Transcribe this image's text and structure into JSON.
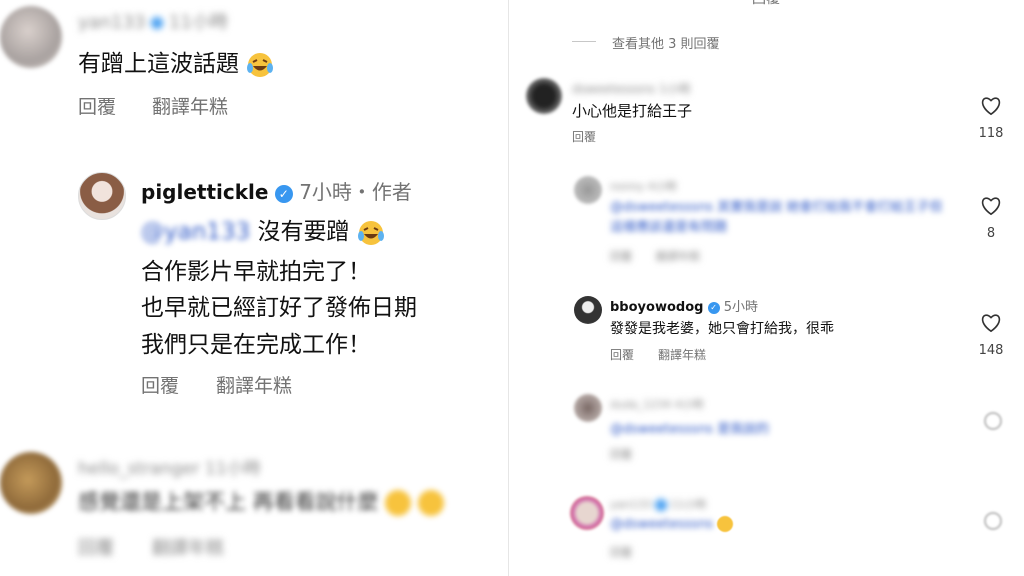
{
  "left": {
    "comment1": {
      "username": "yan133",
      "time": "11小時",
      "text": "有蹭上這波話題",
      "reply": "回覆",
      "translate": "翻譯年糕"
    },
    "reply1": {
      "username": "piglettickle",
      "time_author": "7小時・作者",
      "mention": "@yan133",
      "line1": "沒有要蹭",
      "line2": "合作影片早就拍完了！",
      "line3": "也早就已經訂好了發佈日期",
      "line4": "我們只是在完成工作！",
      "reply": "回覆",
      "translate": "翻譯年糕"
    },
    "comment2": {
      "username": "hello_stranger",
      "time": "11小時",
      "text": "感覺還是上架不上 再看看說什麼",
      "reply": "回覆",
      "translate": "翻譯年糕"
    }
  },
  "right": {
    "top_text": "回覆",
    "view_more": "查看其他 3 則回覆",
    "comment1": {
      "username": "dsweetesssns",
      "time": "1小時",
      "text": "小心他是打給王子",
      "reply": "回覆",
      "likes": "118"
    },
    "reply_a": {
      "username": "nonny",
      "time": "4小時",
      "text": "@dsweetesssns 其實我是說 她會打給我不會打給王子但這樣應該還是有問題",
      "reply": "回覆",
      "translate": "翻譯年糕",
      "likes": "8"
    },
    "reply_b": {
      "username": "bboyowodog",
      "time": "5小時",
      "text": "發發是我老婆，她只會打給我，很乖",
      "reply": "回覆",
      "translate": "翻譯年糕",
      "likes": "148"
    },
    "reply_c": {
      "username": "duda_1234",
      "time": "4小時",
      "text": "@dsweetesssns 是我說的",
      "reply": "回覆"
    },
    "reply_d": {
      "username": "yan133",
      "time": "11小時",
      "text": "@dsweetesssns",
      "reply": "回覆"
    }
  },
  "colors": {
    "verified": "#3897f0",
    "meta": "#737373",
    "mention": "#2f59c7"
  }
}
